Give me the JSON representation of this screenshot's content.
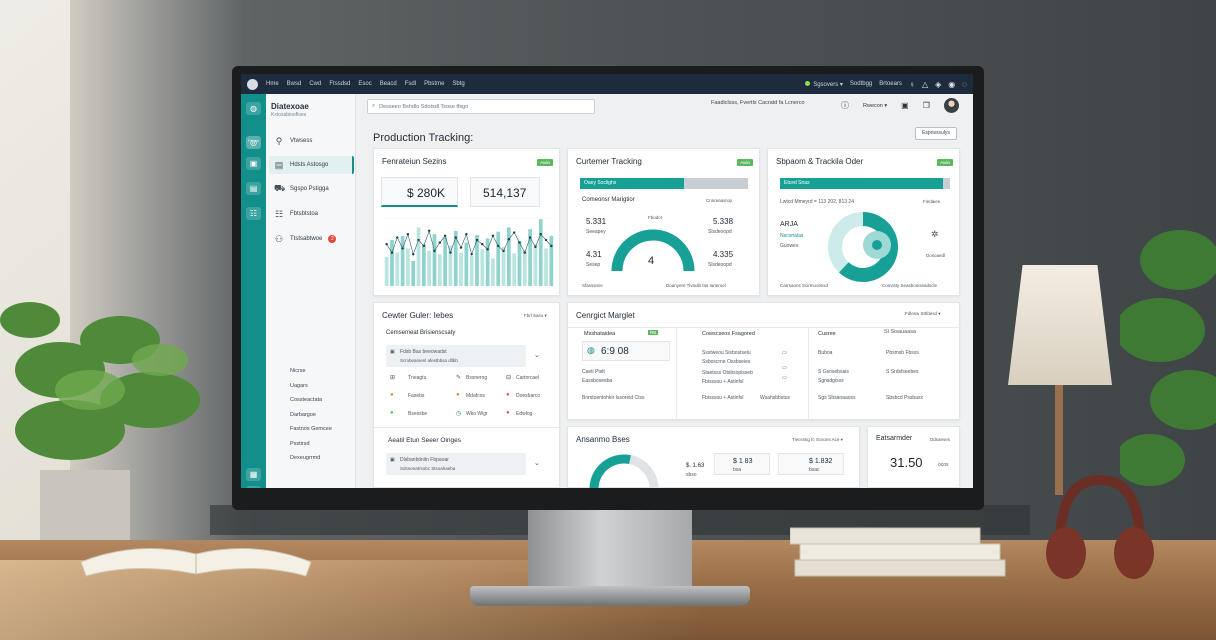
{
  "topbar": {
    "menu": [
      "Hme",
      "Bwsd",
      "Cwd",
      "Ftssdsd",
      "Esoc",
      "Beacd",
      "Fsdl",
      "Pbstme",
      "Sbtg"
    ],
    "status": "Sgsovers",
    "links": [
      "Sodtbgg",
      "Brtoears"
    ]
  },
  "rail": {
    "caption": "Fsooe"
  },
  "sidebar": {
    "brand_title": "Diatexoae",
    "brand_subtitle": "Kxtosabioefloes",
    "nav": [
      {
        "label": "Vtwsess",
        "icon": "gauge-icon"
      },
      {
        "label": "Hdsts Astosgo",
        "icon": "clipboard-icon"
      },
      {
        "label": "Sgspo Pstigga",
        "icon": "truck-icon"
      },
      {
        "label": "Fbtsbtstoa",
        "icon": "people-icon"
      },
      {
        "label": "Ttstsabtwoe",
        "icon": "user-icon",
        "badge": "2"
      }
    ],
    "sub_items": [
      "Nicrse",
      "Uagars",
      "Cossteactata",
      "Darbargoe",
      "Fastnos Gemcee",
      "Psstirsd",
      "Dexeugrrmd"
    ]
  },
  "header": {
    "search_placeholder": "Desseeo Bshdlo Sdotsdl Tsose tfsgo",
    "right_text": "Faadiclsss, Fvertls Cacratd fa Lcnerco",
    "menu_label": "Rwecon"
  },
  "page": {
    "title": "Production Tracking:",
    "action": "Espnsssulys"
  },
  "cards": {
    "production": {
      "title": "Fenrateiun Sezins",
      "flag": "Awio",
      "kpi1": "$ 280K",
      "kpi2": "514,137",
      "chart_data": {
        "type": "bar",
        "title": "",
        "values": [
          35,
          55,
          40,
          60,
          45,
          30,
          70,
          50,
          42,
          62,
          38,
          58,
          48,
          66,
          40,
          52,
          36,
          61,
          44,
          57,
          33,
          65,
          47,
          70,
          39,
          54,
          43,
          68,
          50,
          80,
          45,
          60
        ],
        "overlay": [
          50,
          40,
          58,
          45,
          62,
          38,
          55,
          48,
          66,
          42,
          52,
          60,
          40,
          58,
          46,
          62,
          38,
          55,
          50,
          44,
          60,
          48,
          42,
          56,
          64,
          52,
          40,
          58,
          47,
          62,
          55,
          48
        ]
      }
    },
    "customer_tracking": {
      "title": "Curtemer Tracking",
      "flag": "Awio",
      "bar_label": "Oaey Soclighs",
      "bar_value": 0.62,
      "bar_right": "Cnnreaasrop",
      "section": "Comeonsr Marigtior",
      "mini": "Fbodor",
      "left_top": "5.331",
      "left_top_sub": "Seeapey",
      "left_bottom": "4.31",
      "left_bottom_sub": "Sesep",
      "right_top": "5.338",
      "right_top_sub": "Slsdeoopd",
      "right_bottom": "4.335",
      "right_bottom_sub": "Slsdeoopd",
      "gauge_value": "4",
      "gauge_fraction": 0.55,
      "footer_left": "Sfasssmie",
      "footer_right": "Doanyere Tivaulb fas Iarieroel"
    },
    "shipment": {
      "title": "Sbpaom & Trackila Oder",
      "flag": "Awio",
      "bar_label": "Etced Snas",
      "bar_value": 0.96,
      "bar_right": "Fiedaiee",
      "line": "Lwtcd Mmeyrd = 113 202, 813 24",
      "left_a": "ARJA",
      "left_b": "Nsconalas",
      "left_c": "Guowes",
      "donut_fraction": 0.62,
      "right_icon": "asterisk-icon",
      "right_text": "Dosoaedl",
      "footer_left": "Carrsaons Scirtnuotinsd",
      "footer_right": "Convisty Seasboniseadscle"
    },
    "orders": {
      "title": "Cewter Guler: Iebes",
      "right": "Fbrl Saso",
      "sub": "Cemsemeat Brisienscsaty",
      "input": "Fdsb Bas beeowadst",
      "input_sub": "Scmbeamenl afestbbsa dllbb",
      "grid": [
        "Tneagtu",
        "Bssnerog",
        "Cartnrcael",
        "Fasebs",
        "Mdafcos",
        "Doesbarco",
        "Bsessbe",
        "Wko Wigr",
        "Edwlog"
      ],
      "section2": "Aeatil Etun Seeer Oinges",
      "input2": "Dlsbanbtinitn Fbpaoar",
      "input2_sub": "Sdsneeatrsobc Stsoahaeba"
    },
    "insights": {
      "title": "Cenrgict Marglet",
      "right": "Fdlesw Sttfdesd",
      "col1": "Msshataidea",
      "badge": "RB",
      "big": "6:9 08",
      "col1_row1": "Caeti Ptslt",
      "col1_row2": "Eassboseeba",
      "col1_foot": "Bnrstoentohkir Issoreid Ctss",
      "col2": "Cowscseos Fsagored",
      "col2_rows": [
        "Ssstweou Sisbostseiu",
        "Ssboscrne Ossbseies",
        "Staetsss Otsbsopisseb",
        "Fbisssou + Astinfsl"
      ],
      "col2_foot": "Wsahsbbstus",
      "col3": "Cusree",
      "col3_right": "Si Sisauaasa",
      "col3_rows": [
        "Buboa",
        "S Gsosebsais",
        "Sgnsdgisss",
        "Sgs Sbsaoaaoss"
      ],
      "col4_rows": [
        "Pbsmsb Fbsxs",
        "S Srdsfseebes",
        "Sbsbcd Pssbasx"
      ]
    },
    "anomaly": {
      "title": "Ansanmo Bses",
      "right": "Tiecsntig fc Scsons Ace",
      "v1": "$. 1.63",
      "v1_sub": "sbso",
      "v2": "$ 1 83",
      "v2_sub": "bsa",
      "v3": "$ 1.832",
      "v3_sub": "bsac"
    },
    "reminder": {
      "title": "Eatsarmder",
      "right": "Ddsaeses",
      "value": "31.50",
      "unit": "ocos"
    }
  },
  "colors": {
    "accent": "#17a096",
    "rail": "#138f8b",
    "topbar": "#1e2b3d"
  }
}
